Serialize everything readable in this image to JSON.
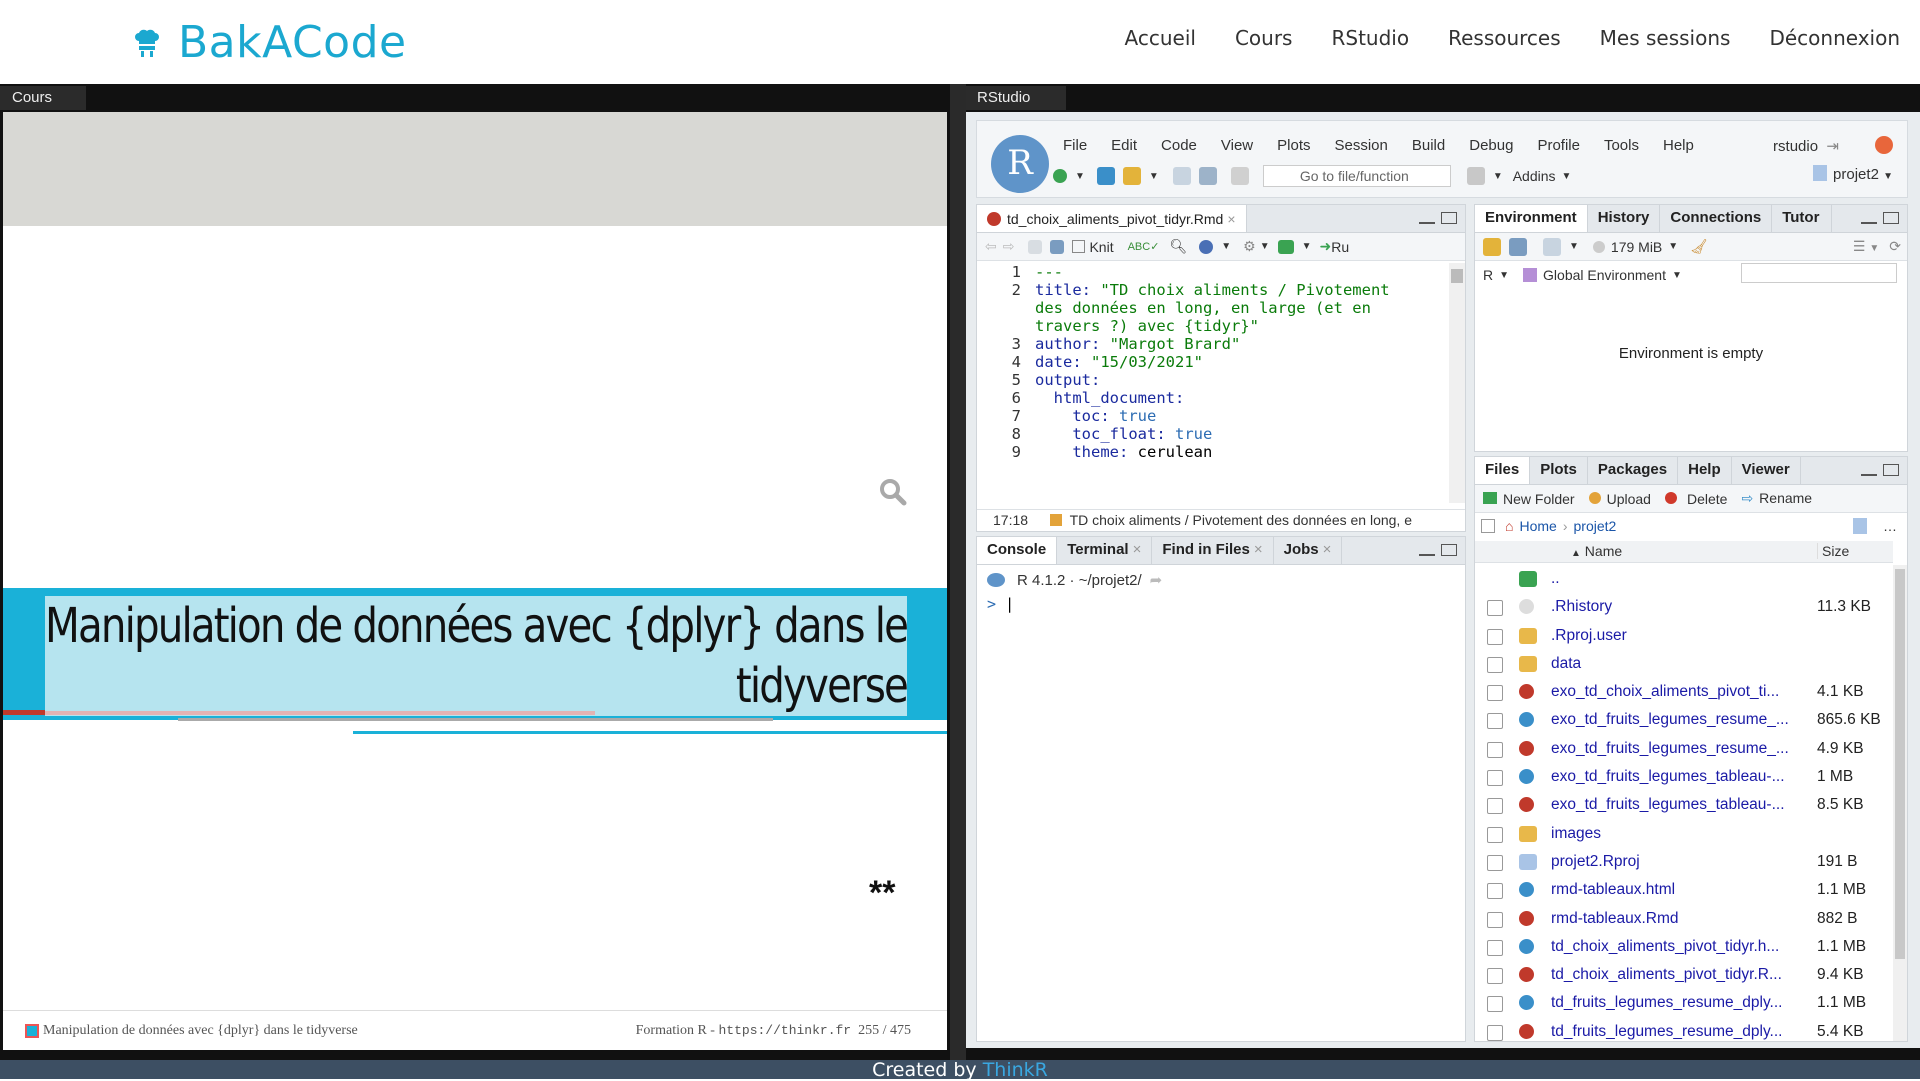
{
  "brand": {
    "name": "BakACode"
  },
  "nav": [
    "Accueil",
    "Cours",
    "RStudio",
    "Ressources",
    "Mes sessions",
    "Déconnexion"
  ],
  "cours": {
    "tab_label": "Cours",
    "slide_title_line1": "Manipulation de données avec {dplyr} dans le",
    "slide_title_line2": "tidyverse",
    "stars": "**",
    "footer_left": "Manipulation de données avec {dplyr} dans le tidyverse",
    "footer_right_prefix": "Formation R - ",
    "footer_url": "https://thinkr.fr",
    "page_counter": "255 / 475"
  },
  "rstudio": {
    "tab_label": "RStudio",
    "logo_letter": "R",
    "menu": [
      "File",
      "Edit",
      "Code",
      "View",
      "Plots",
      "Session",
      "Build",
      "Debug",
      "Profile",
      "Tools",
      "Help"
    ],
    "user": "rstudio",
    "goto_placeholder": "Go to file/function",
    "addins_label": "Addins",
    "project_label": "projet2",
    "source": {
      "file_tab": "td_choix_aliments_pivot_tidyr.Rmd",
      "knit_label": "Knit",
      "run_label": "Ru",
      "cursor_pos": "17:18",
      "status_text": "TD choix aliments / Pivotement des données en long, e",
      "lines": [
        {
          "n": "1",
          "parts": [
            {
              "t": "---",
              "c": "s"
            }
          ]
        },
        {
          "n": "2",
          "parts": [
            {
              "t": "title: ",
              "c": "k"
            },
            {
              "t": "\"TD choix aliments / Pivotement",
              "c": "s"
            }
          ]
        },
        {
          "n": "",
          "parts": [
            {
              "t": "des données en long, en large (et en",
              "c": "s"
            }
          ]
        },
        {
          "n": "",
          "parts": [
            {
              "t": "travers ?) avec {tidyr}\"",
              "c": "s"
            }
          ]
        },
        {
          "n": "3",
          "parts": [
            {
              "t": "author: ",
              "c": "k"
            },
            {
              "t": "\"Margot Brard\"",
              "c": "s"
            }
          ]
        },
        {
          "n": "4",
          "parts": [
            {
              "t": "date: ",
              "c": "k"
            },
            {
              "t": "\"15/03/2021\"",
              "c": "s"
            }
          ]
        },
        {
          "n": "5",
          "parts": [
            {
              "t": "output:",
              "c": "k"
            }
          ]
        },
        {
          "n": "6",
          "parts": [
            {
              "t": "  html_document:",
              "c": "k"
            }
          ]
        },
        {
          "n": "7",
          "parts": [
            {
              "t": "    toc: ",
              "c": "k"
            },
            {
              "t": "true",
              "c": "b"
            }
          ]
        },
        {
          "n": "8",
          "parts": [
            {
              "t": "    toc_float: ",
              "c": "k"
            },
            {
              "t": "true",
              "c": "b"
            }
          ]
        },
        {
          "n": "9",
          "parts": [
            {
              "t": "    theme: ",
              "c": "k"
            },
            {
              "t": "cerulean",
              "c": "n"
            }
          ]
        }
      ]
    },
    "console": {
      "tabs": [
        "Console",
        "Terminal",
        "Find in Files",
        "Jobs"
      ],
      "version": "R 4.1.2 · ~/projet2/",
      "prompt": ">"
    },
    "environment": {
      "tabs": [
        "Environment",
        "History",
        "Connections",
        "Tutor"
      ],
      "memory": "179 MiB",
      "lang": "R",
      "scope": "Global Environment",
      "empty_text": "Environment is empty"
    },
    "files": {
      "tabs": [
        "Files",
        "Plots",
        "Packages",
        "Help",
        "Viewer"
      ],
      "actions": [
        "New Folder",
        "Upload",
        "Delete",
        "Rename"
      ],
      "path": [
        "Home",
        "projet2"
      ],
      "col_name": "Name",
      "col_size": "Size",
      "rows": [
        {
          "name": "..",
          "size": "",
          "icon": "up",
          "check": false
        },
        {
          "name": ".Rhistory",
          "size": "11.3 KB",
          "icon": "hist",
          "check": true
        },
        {
          "name": ".Rproj.user",
          "size": "",
          "icon": "folder",
          "check": true
        },
        {
          "name": "data",
          "size": "",
          "icon": "folder",
          "check": true
        },
        {
          "name": "exo_td_choix_aliments_pivot_ti...",
          "size": "4.1 KB",
          "icon": "rmd",
          "check": true
        },
        {
          "name": "exo_td_fruits_legumes_resume_...",
          "size": "865.6 KB",
          "icon": "html",
          "check": true
        },
        {
          "name": "exo_td_fruits_legumes_resume_...",
          "size": "4.9 KB",
          "icon": "rmd",
          "check": true
        },
        {
          "name": "exo_td_fruits_legumes_tableau-...",
          "size": "1 MB",
          "icon": "html",
          "check": true
        },
        {
          "name": "exo_td_fruits_legumes_tableau-...",
          "size": "8.5 KB",
          "icon": "rmd",
          "check": true
        },
        {
          "name": "images",
          "size": "",
          "icon": "folder",
          "check": true
        },
        {
          "name": "projet2.Rproj",
          "size": "191 B",
          "icon": "rproj",
          "check": true
        },
        {
          "name": "rmd-tableaux.html",
          "size": "1.1 MB",
          "icon": "html",
          "check": true
        },
        {
          "name": "rmd-tableaux.Rmd",
          "size": "882 B",
          "icon": "rmd",
          "check": true
        },
        {
          "name": "td_choix_aliments_pivot_tidyr.h...",
          "size": "1.1 MB",
          "icon": "html",
          "check": true
        },
        {
          "name": "td_choix_aliments_pivot_tidyr.R...",
          "size": "9.4 KB",
          "icon": "rmd",
          "check": true
        },
        {
          "name": "td_fruits_legumes_resume_dply...",
          "size": "1.1 MB",
          "icon": "html",
          "check": true
        },
        {
          "name": "td_fruits_legumes_resume_dply...",
          "size": "5.4 KB",
          "icon": "rmd",
          "check": true
        }
      ]
    }
  },
  "footer": {
    "text": "Created by ",
    "link": "ThinkR"
  },
  "colors": {
    "brand": "#1ba8d0",
    "slide_blue": "#1ab1d8",
    "r_blue": "#5f94c9"
  }
}
